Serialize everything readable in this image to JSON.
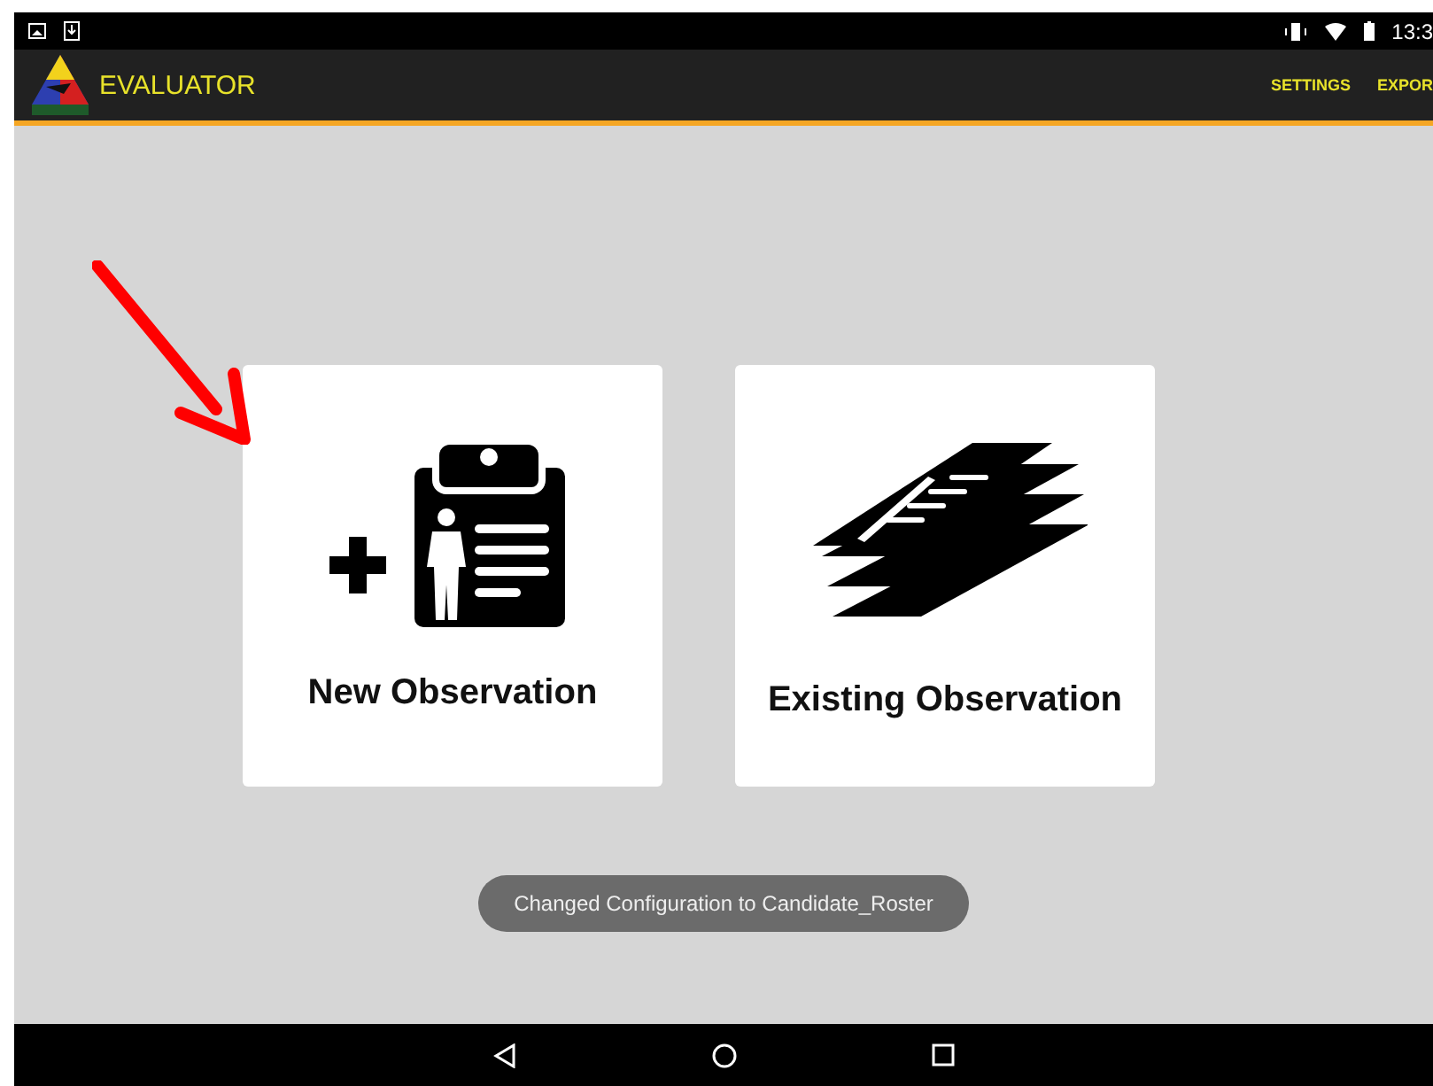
{
  "status_bar": {
    "time": "13:3"
  },
  "app_bar": {
    "title": "EVALUATOR",
    "actions": [
      "SETTINGS",
      "EXPOR"
    ]
  },
  "tiles": [
    {
      "kind": "new",
      "label": "New Observation"
    },
    {
      "kind": "existing",
      "label": "Existing Observation"
    }
  ],
  "toast": "Changed Configuration to Candidate_Roster"
}
